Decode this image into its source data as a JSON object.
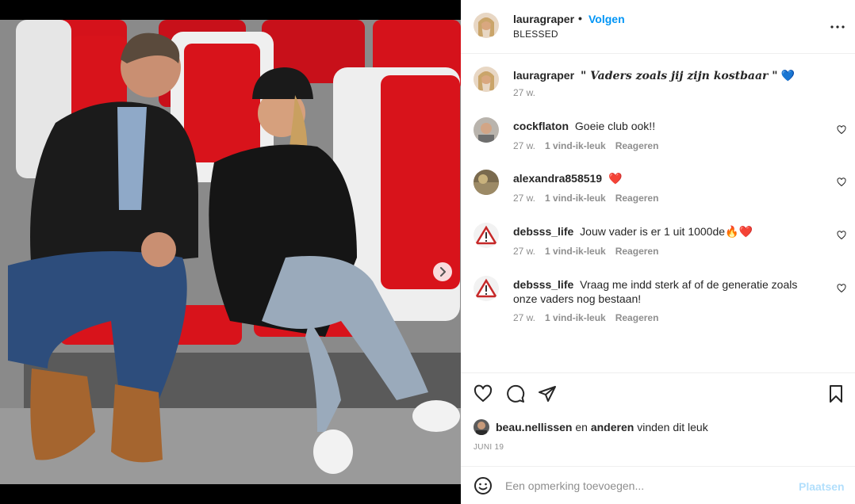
{
  "header": {
    "username": "lauragraper",
    "separator": "•",
    "follow_label": "Volgen",
    "location": "BLESSED"
  },
  "caption": {
    "username": "lauragraper",
    "text": "\" Vaders zoals jij zijn kostbaar \"",
    "emoji": "💙",
    "time": "27 w."
  },
  "comments": [
    {
      "username": "cockflaton",
      "text": "Goeie club ook!!",
      "time": "27 w.",
      "likes": "1 vind-ik-leuk",
      "reply": "Reageren"
    },
    {
      "username": "alexandra858519",
      "text": "❤️",
      "time": "27 w.",
      "likes": "1 vind-ik-leuk",
      "reply": "Reageren"
    },
    {
      "username": "debsss_life",
      "text": "Jouw vader is er 1 uit 1000de🔥❤️",
      "time": "27 w.",
      "likes": "1 vind-ik-leuk",
      "reply": "Reageren"
    },
    {
      "username": "debsss_life",
      "text": "Vraag me indd sterk af of de generatie zoals onze vaders nog bestaan!",
      "time": "27 w.",
      "likes": "1 vind-ik-leuk",
      "reply": "Reageren"
    }
  ],
  "likes_line": {
    "user": "beau.nellissen",
    "and": "en",
    "others": "anderen",
    "suffix": "vinden dit leuk"
  },
  "date": "JUNI 19",
  "add_comment": {
    "placeholder": "Een opmerking toevoegen...",
    "post_label": "Plaatsen"
  },
  "carousel": {
    "slide_count": 3,
    "active_index": 0
  },
  "colors": {
    "accent": "#0095f6",
    "post_disabled": "#b2dffc",
    "seat_red": "#d8131b"
  },
  "icons": [
    "more-icon",
    "heart-icon",
    "comment-icon",
    "share-icon",
    "bookmark-icon",
    "emoji-icon",
    "chevron-right-icon"
  ]
}
